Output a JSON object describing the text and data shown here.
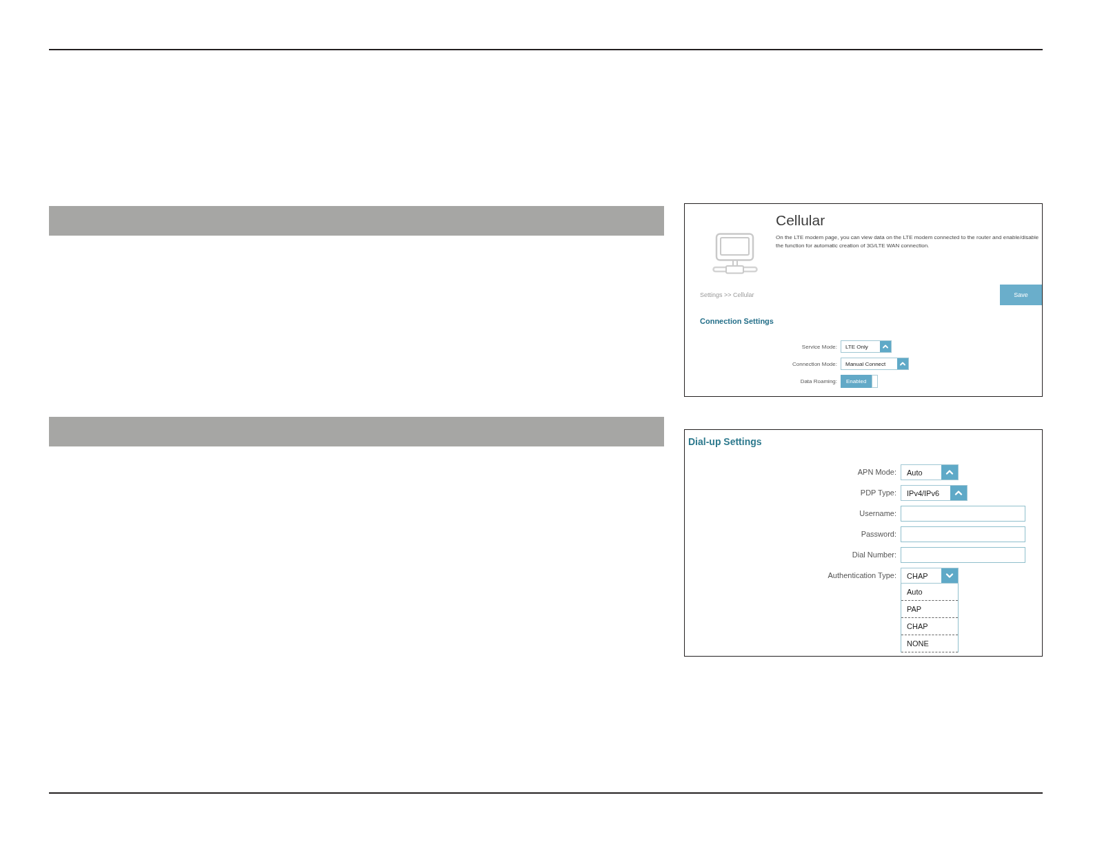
{
  "cellular_page": {
    "title": "Cellular",
    "description": "On the LTE modem page, you can view data on the LTE modem connected to the router and enable/disable the function for automatic creation of 3G/LTE WAN connection.",
    "breadcrumb": "Settings >> Cellular",
    "save_button": "Save",
    "section_title": "Connection Settings",
    "fields": [
      {
        "kind": "select",
        "label": "Service Mode:",
        "value": "LTE Only",
        "expanded": false
      },
      {
        "kind": "select",
        "label": "Connection Mode:",
        "value": "Manual Connect",
        "expanded": false
      },
      {
        "kind": "toggle",
        "label": "Data Roaming:",
        "value": "Enabled",
        "on": true
      }
    ]
  },
  "dialup_settings": {
    "title": "Dial-up Settings",
    "fields": [
      {
        "kind": "select",
        "label": "APN Mode:",
        "value": "Auto",
        "expanded": false
      },
      {
        "kind": "select",
        "label": "PDP Type:",
        "value": "IPv4/IPv6",
        "expanded": false
      },
      {
        "kind": "text",
        "label": "Username:"
      },
      {
        "kind": "text",
        "label": "Password:"
      },
      {
        "kind": "text",
        "label": "Dial Number:"
      },
      {
        "kind": "select",
        "label": "Authentication Type:",
        "value": "CHAP",
        "expanded": true,
        "options": [
          "Auto",
          "PAP",
          "CHAP",
          "NONE"
        ]
      }
    ]
  }
}
